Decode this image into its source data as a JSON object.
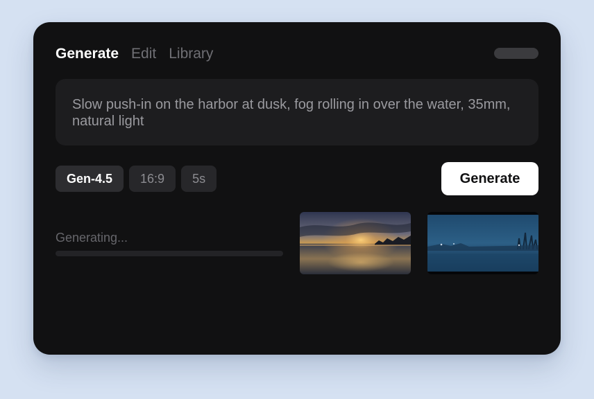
{
  "tabs": [
    {
      "label": "Generate",
      "active": true
    },
    {
      "label": "Edit",
      "active": false
    },
    {
      "label": "Library",
      "active": false
    }
  ],
  "prompt": {
    "text": "Slow push-in on the harbor at dusk, fog rolling in over the water, 35mm, natural light"
  },
  "options": {
    "model": "Gen-4.5",
    "aspect_ratio": "16:9",
    "duration": "5s"
  },
  "generate_button": {
    "label": "Generate"
  },
  "status": {
    "text": "Generating..."
  },
  "thumbnails": [
    {
      "icon": "sunset-lake-thumbnail"
    },
    {
      "icon": "foggy-harbor-thumbnail"
    }
  ],
  "colors": {
    "background": "#d5e1f2",
    "card": "#111112",
    "accent_button": "#ffffff"
  }
}
